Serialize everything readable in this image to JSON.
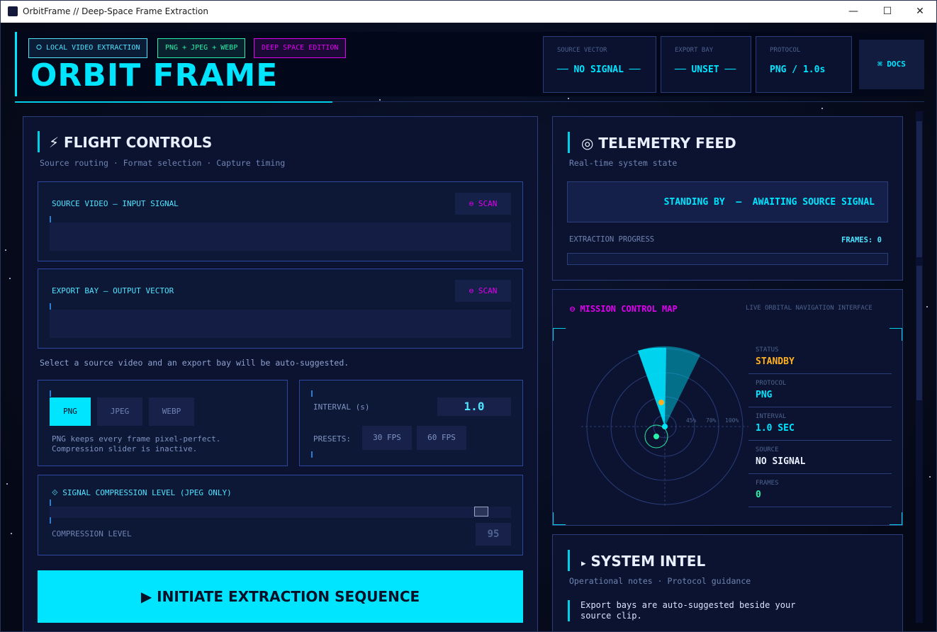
{
  "window": {
    "title": "OrbitFrame  //  Deep-Space Frame Extraction",
    "minimize": "—",
    "maximize": "☐",
    "close": "✕"
  },
  "header": {
    "pills": [
      "⭘ LOCAL VIDEO EXTRACTION",
      "PNG + JPEG + WEBP",
      "DEEP SPACE EDITION"
    ],
    "brand": "ORBIT FRAME",
    "stats": [
      {
        "label": "SOURCE VECTOR",
        "value": "── NO SIGNAL ──"
      },
      {
        "label": "EXPORT BAY",
        "value": "── UNSET ──"
      },
      {
        "label": "PROTOCOL",
        "value": "PNG  /  1.0s"
      }
    ],
    "docs": "⌘  DOCS"
  },
  "flight": {
    "icon": "⚡",
    "title": "FLIGHT CONTROLS",
    "subtitle": "Source routing · Format selection · Capture timing",
    "source_label": "SOURCE VIDEO — INPUT SIGNAL",
    "export_label": "EXPORT BAY — OUTPUT VECTOR",
    "scan": "⊖ SCAN",
    "hint": "Select a source video and an export bay will be auto-suggested.",
    "formats": [
      "PNG",
      "JPEG",
      "WEBP"
    ],
    "format_note": "PNG keeps every frame pixel-perfect.\nCompression slider is inactive.",
    "interval_label": "INTERVAL (s)",
    "interval_value": "1.0",
    "presets_label": "PRESETS:",
    "presets": [
      "30 FPS",
      "60 FPS"
    ],
    "compression_title": "⟐  SIGNAL COMPRESSION LEVEL  (JPEG ONLY)",
    "compression_label": "COMPRESSION LEVEL",
    "compression_value": "95",
    "compression_fraction": 0.95,
    "initiate": "▶  INITIATE EXTRACTION SEQUENCE"
  },
  "telemetry": {
    "icon": "◎",
    "title": "TELEMETRY FEED",
    "subtitle": "Real-time system state",
    "status": "STANDING BY  —  AWAITING SOURCE SIGNAL",
    "progress_label": "EXTRACTION PROGRESS",
    "frames_label": "FRAMES: 0",
    "progress": 0
  },
  "map": {
    "title": "⊖ MISSION CONTROL MAP",
    "subtitle": "LIVE ORBITAL NAVIGATION INTERFACE",
    "ring_labels": [
      "45%",
      "70%",
      "100%"
    ],
    "rows": [
      {
        "k": "STATUS",
        "v": "STANDBY",
        "color": "#ffb020"
      },
      {
        "k": "PROTOCOL",
        "v": "PNG",
        "color": "#00e5ff"
      },
      {
        "k": "INTERVAL",
        "v": "1.0 SEC",
        "color": "#00e5ff"
      },
      {
        "k": "SOURCE",
        "v": "NO SIGNAL",
        "color": "#e8f0ff"
      },
      {
        "k": "FRAMES",
        "v": "0",
        "color": "#2bf0a8"
      }
    ]
  },
  "intel": {
    "icon": "▸",
    "title": "SYSTEM INTEL",
    "subtitle": "Operational notes · Protocol guidance",
    "note": "Export bays are auto-suggested beside your source clip."
  }
}
